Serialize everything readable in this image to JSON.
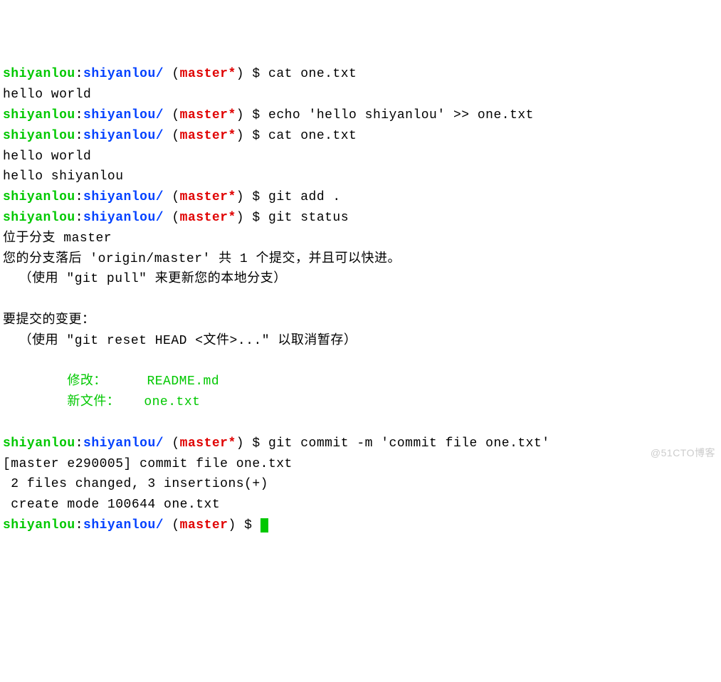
{
  "prompts": [
    {
      "user": "shiyanlou",
      "host": "shiyanlou/",
      "branch": "master*",
      "cmd": "cat one.txt"
    },
    {
      "user": "shiyanlou",
      "host": "shiyanlou/",
      "branch": "master*",
      "cmd": "echo 'hello shiyanlou' >> one.txt"
    },
    {
      "user": "shiyanlou",
      "host": "shiyanlou/",
      "branch": "master*",
      "cmd": "cat one.txt"
    },
    {
      "user": "shiyanlou",
      "host": "shiyanlou/",
      "branch": "master*",
      "cmd": "git add ."
    },
    {
      "user": "shiyanlou",
      "host": "shiyanlou/",
      "branch": "master*",
      "cmd": "git status"
    },
    {
      "user": "shiyanlou",
      "host": "shiyanlou/",
      "branch": "master*",
      "cmd": "git commit -m 'commit file one.txt'"
    },
    {
      "user": "shiyanlou",
      "host": "shiyanlou/",
      "branch": "master",
      "cmd": ""
    }
  ],
  "out": {
    "cat1": "hello world",
    "cat2_l1": "hello world",
    "cat2_l2": "hello shiyanlou",
    "status_branch": "位于分支 master",
    "status_behind": "您的分支落后 'origin/master' 共 1 个提交，并且可以快进。",
    "status_pull_hint": "  （使用 \"git pull\" 来更新您的本地分支）",
    "status_blank": "",
    "status_changes_heading": "要提交的变更：",
    "status_reset_hint": "  （使用 \"git reset HEAD <文件>...\" 以取消暂存）",
    "status_modified_label": "        修改：     ",
    "status_modified_file": "README.md",
    "status_newfile_label": "        新文件：   ",
    "status_newfile_file": "one.txt",
    "commit_result1": "[master e290005] commit file one.txt",
    "commit_result2": " 2 files changed, 3 insertions(+)",
    "commit_result3": " create mode 100644 one.txt"
  },
  "watermark": "@51CTO博客",
  "symbols": {
    "colon": ":",
    "dollar": " $ ",
    "lp": " (",
    "rp": ")"
  }
}
